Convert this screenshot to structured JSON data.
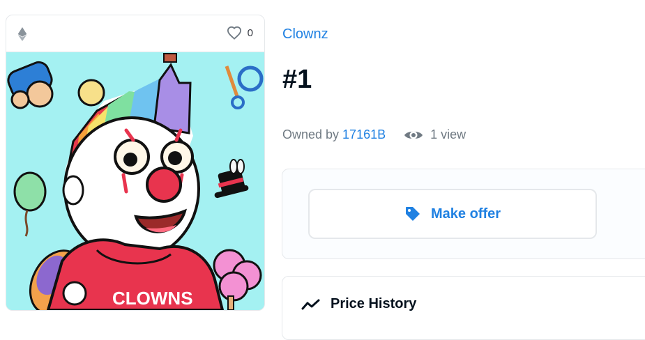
{
  "item_card": {
    "favorite_count": "0",
    "art_text": "CLOWNS"
  },
  "collection": {
    "name": "Clownz"
  },
  "token": {
    "title": "#1"
  },
  "ownership": {
    "owned_by_label": "Owned by",
    "owner": "17161B",
    "views": "1 view"
  },
  "actions": {
    "make_offer_label": "Make offer"
  },
  "price_history": {
    "label": "Price History"
  },
  "colors": {
    "accent": "#2081e2",
    "art_background": "#a4f1f2",
    "hoodie": "#e8344e"
  }
}
